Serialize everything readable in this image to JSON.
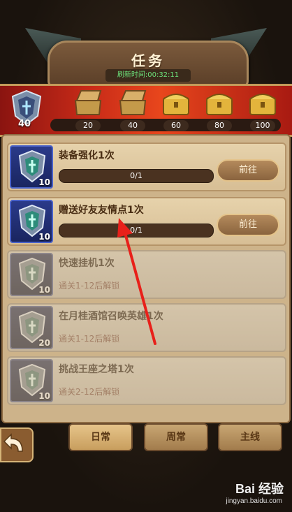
{
  "header": {
    "title": "任务",
    "refresh_label": "刷新时间:00:32:11"
  },
  "rewards": {
    "current_points": "40",
    "chests": [
      {
        "value": "20"
      },
      {
        "value": "40"
      },
      {
        "value": "60"
      },
      {
        "value": "80"
      },
      {
        "value": "100"
      }
    ]
  },
  "tasks": [
    {
      "title": "装备强化1次",
      "level": "10",
      "progress": "0/1",
      "button": "前往",
      "locked": false
    },
    {
      "title": "赠送好友友情点1次",
      "level": "10",
      "progress": "0/1",
      "button": "前往",
      "locked": false
    },
    {
      "title": "快速挂机1次",
      "level": "10",
      "unlock": "通关1-12后解锁",
      "locked": true
    },
    {
      "title": "在月桂酒馆召唤英雄1次",
      "level": "20",
      "unlock": "通关1-12后解锁",
      "locked": true
    },
    {
      "title": "挑战王座之塔1次",
      "level": "10",
      "unlock": "通关2-12后解锁",
      "locked": true
    }
  ],
  "tabs": [
    {
      "label": "日常"
    },
    {
      "label": "周常"
    },
    {
      "label": "主线"
    }
  ],
  "watermark": {
    "main": "Bai 经验",
    "sub": "jingyan.baidu.com"
  }
}
